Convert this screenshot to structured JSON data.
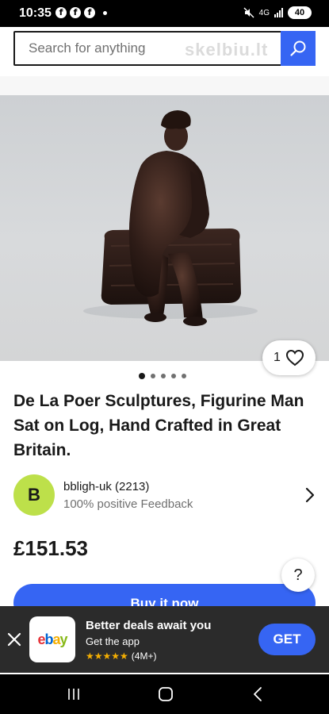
{
  "status_bar": {
    "time": "10:35",
    "network": "4G",
    "battery": "40",
    "notifications": [
      "facebook-icon",
      "facebook-icon",
      "facebook-icon"
    ]
  },
  "search": {
    "placeholder": "Search for anything",
    "watermark": "skelbiu.lt"
  },
  "product": {
    "watch_count": "1",
    "image_count": 5,
    "active_image": 1,
    "title": "De La Poer Sculptures, Figurine Man Sat on Log, Hand Crafted in Great Britain.",
    "price": "£151.53"
  },
  "seller": {
    "initial": "B",
    "name": "bbligh-uk (2213)",
    "feedback": "100% positive Feedback"
  },
  "actions": {
    "buy_now": "Buy it now",
    "help": "?"
  },
  "app_banner": {
    "logo": "ebay",
    "title": "Better deals await you",
    "subtitle": "Get the app",
    "rating_count": "(4M+)",
    "get_label": "GET"
  },
  "colors": {
    "accent": "#3665f3",
    "avatar": "#bde04a",
    "banner_bg": "#2b2b2b",
    "stars": "#f5af02"
  }
}
